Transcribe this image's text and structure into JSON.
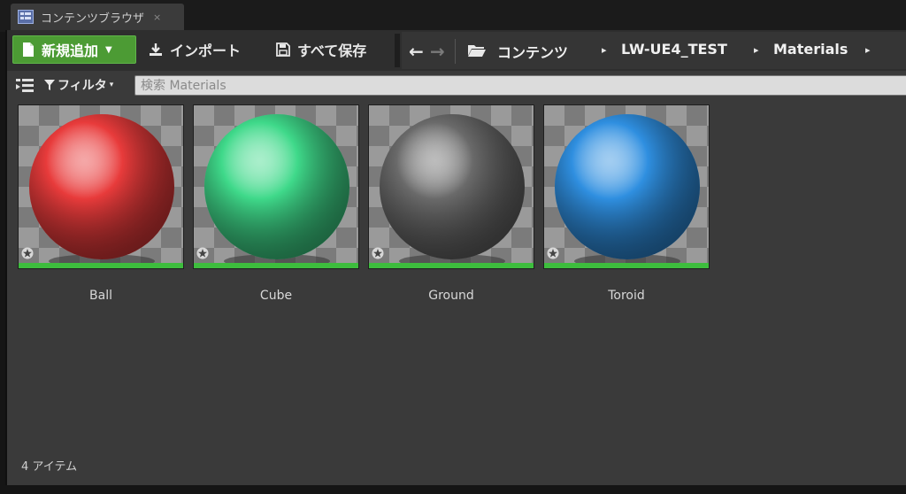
{
  "tab": {
    "title": "コンテンツブラウザ",
    "close": "×"
  },
  "toolbar": {
    "new_label": "新規追加",
    "import_label": "インポート",
    "saveall_label": "すべて保存"
  },
  "nav": {
    "back": "←",
    "forward": "→",
    "breadcrumbs": [
      "コンテンツ",
      "LW-UE4_TEST",
      "Materials"
    ],
    "crumb_separator": "▸"
  },
  "filter": {
    "label": "フィルタ",
    "caret": "▾",
    "search_placeholder": "検索 Materials"
  },
  "assets": [
    {
      "name": "Ball",
      "color": "#e83b3b"
    },
    {
      "name": "Cube",
      "color": "#3fd98a"
    },
    {
      "name": "Ground",
      "color": "#6a6a6a"
    },
    {
      "name": "Toroid",
      "color": "#2f8fe0"
    }
  ],
  "status": {
    "count_text": "4 アイテム"
  },
  "colors": {
    "accent_green": "#4c9b34",
    "thumb_bar": "#3dbd3d"
  }
}
